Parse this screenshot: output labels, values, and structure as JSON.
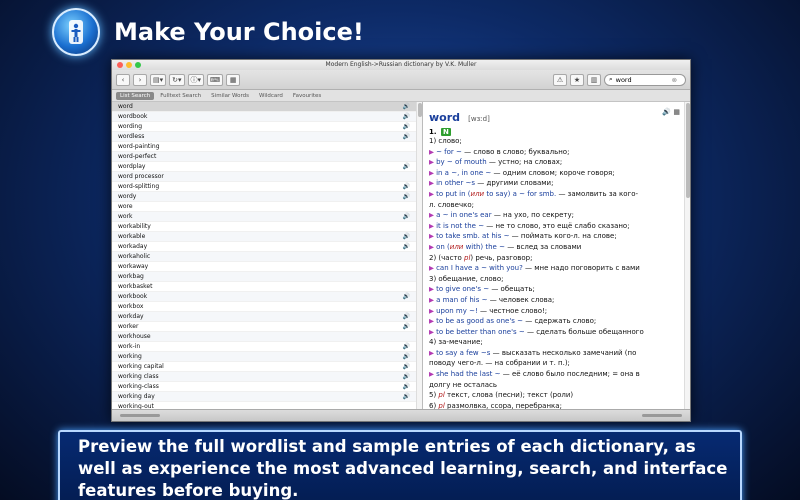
{
  "banner": {
    "title": "Make Your Choice!",
    "icon": "accessibility-app-icon"
  },
  "window": {
    "title": "Modern English->Russian dictionary by V.K. Muller",
    "traffic_colors": [
      "#fc5f57",
      "#fdbc2e",
      "#33c748"
    ]
  },
  "toolbar": {
    "back": "‹",
    "forward": "›",
    "search_value": "word"
  },
  "tabs": [
    {
      "label": "List Search",
      "active": true
    },
    {
      "label": "Fulltext Search",
      "active": false
    },
    {
      "label": "Similar Words",
      "active": false
    },
    {
      "label": "Wildcard",
      "active": false
    },
    {
      "label": "Favourites",
      "active": false
    }
  ],
  "wordlist": [
    {
      "word": "word",
      "audio": true
    },
    {
      "word": "wordbook",
      "audio": true
    },
    {
      "word": "wording",
      "audio": true
    },
    {
      "word": "wordless",
      "audio": true
    },
    {
      "word": "word-painting",
      "audio": false
    },
    {
      "word": "word-perfect",
      "audio": false
    },
    {
      "word": "wordplay",
      "audio": true
    },
    {
      "word": "word processor",
      "audio": false
    },
    {
      "word": "word-splitting",
      "audio": true
    },
    {
      "word": "wordy",
      "audio": true
    },
    {
      "word": "wore",
      "audio": false
    },
    {
      "word": "work",
      "audio": true
    },
    {
      "word": "workability",
      "audio": false
    },
    {
      "word": "workable",
      "audio": true
    },
    {
      "word": "workaday",
      "audio": true
    },
    {
      "word": "workaholic",
      "audio": false
    },
    {
      "word": "workaway",
      "audio": false
    },
    {
      "word": "workbag",
      "audio": false
    },
    {
      "word": "workbasket",
      "audio": false
    },
    {
      "word": "workbook",
      "audio": true
    },
    {
      "word": "workbox",
      "audio": false
    },
    {
      "word": "workday",
      "audio": true
    },
    {
      "word": "worker",
      "audio": true
    },
    {
      "word": "workhouse",
      "audio": false
    },
    {
      "word": "work-in",
      "audio": true
    },
    {
      "word": "working",
      "audio": true
    },
    {
      "word": "working capital",
      "audio": true
    },
    {
      "word": "working class",
      "audio": true
    },
    {
      "word": "working-class",
      "audio": true
    },
    {
      "word": "working day",
      "audio": true
    },
    {
      "word": "working-out",
      "audio": false
    }
  ],
  "entry": {
    "headword": "word",
    "transcription": "[wɜːd]",
    "sense_number": "1.",
    "pos": "N",
    "lines": [
      {
        "t": "plain",
        "text": "1) слово;"
      },
      {
        "t": "ex",
        "en": "~ for ~",
        "ru": " — слово в слово; буквально;"
      },
      {
        "t": "ex",
        "en": "by ~ of mouth",
        "ru": " — устно; на словах;"
      },
      {
        "t": "ex",
        "en": "in a ~, in one ~",
        "ru": " — одним словом; короче говоря;"
      },
      {
        "t": "ex",
        "en": "in other ~s",
        "ru": " — другими словами;"
      },
      {
        "t": "exi",
        "en1": "to put in (",
        "it": "или",
        "en2": " to say) a ~ for smb.",
        "ru": " — замолвить за кого-"
      },
      {
        "t": "plain",
        "text": "л. словечко;"
      },
      {
        "t": "ex",
        "en": "a ~ in one's ear",
        "ru": " — на ухо, по секрету;"
      },
      {
        "t": "ex",
        "en": "it is not the ~",
        "ru": " — не то слово, это ещё слабо сказано;"
      },
      {
        "t": "ex",
        "en": "to take smb. at his ~",
        "ru": " — поймать кого-л. на слове;"
      },
      {
        "t": "exi",
        "en1": "on (",
        "it": "или",
        "en2": " with) the ~",
        "ru": " — вслед за словами"
      },
      {
        "t": "pl",
        "pre": "2) (часто ",
        "it": "pl",
        "post": ") речь, разговор;"
      },
      {
        "t": "ex",
        "en": "can I have a ~ with you?",
        "ru": " — мне надо поговорить с вами"
      },
      {
        "t": "plain",
        "text": "3) обещание, слово;"
      },
      {
        "t": "ex",
        "en": "to give one's ~",
        "ru": " — обещать;"
      },
      {
        "t": "ex",
        "en": "a man of his ~",
        "ru": " — человек слова;"
      },
      {
        "t": "ex",
        "en": "upon my ~!",
        "ru": " — честное слово!;"
      },
      {
        "t": "ex",
        "en": "to be as good as one's ~",
        "ru": " — сдержать слово;"
      },
      {
        "t": "ex",
        "en": "to be better than one's ~",
        "ru": " — сделать больше обещанного"
      },
      {
        "t": "plain",
        "text": "4) за-мечание;"
      },
      {
        "t": "ex",
        "en": "to say a few ~s",
        "ru": " — высказать несколько замечаний (по"
      },
      {
        "t": "plain",
        "text": "поводу чего-л. — на собрании и т. п.);"
      },
      {
        "t": "ex",
        "en": "she had the last ~",
        "ru": " — её слово было последним; = она в"
      },
      {
        "t": "plain",
        "text": "долгу не осталась"
      },
      {
        "t": "pl",
        "pre": "5) ",
        "it": "pl",
        "post": " текст, слова (песни); текст (роли)"
      },
      {
        "t": "pl",
        "pre": "6) ",
        "it": "pl",
        "post": " размолвка, ссора, перебранка;"
      }
    ]
  },
  "caption": "Preview the full wordlist and sample entries of each dictionary, as well as experience the most advanced learning, search, and interface features before buying."
}
